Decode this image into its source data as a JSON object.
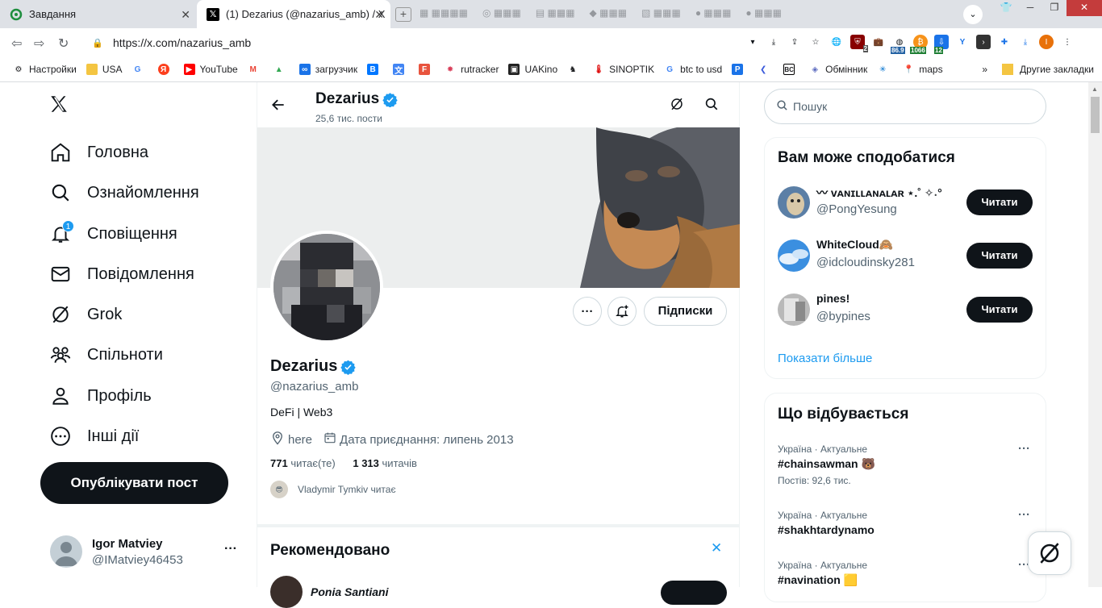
{
  "browser": {
    "tabs": [
      {
        "title": "Завдання",
        "favicon": "green-ring-icon"
      },
      {
        "title": "(1) Dezarius (@nazarius_amb) / X",
        "favicon": "x-logo-icon"
      }
    ],
    "url": "https://x.com/nazarius_amb",
    "bookmarks": [
      {
        "label": "Настройки",
        "icon": "gear-icon"
      },
      {
        "label": "USA",
        "icon": "folder-icon"
      },
      {
        "label": "",
        "icon": "google-icon"
      },
      {
        "label": "",
        "icon": "yandex-icon"
      },
      {
        "label": "YouTube",
        "icon": "youtube-icon"
      },
      {
        "label": "",
        "icon": "gmail-icon"
      },
      {
        "label": "",
        "icon": "drive-icon"
      },
      {
        "label": "загрузчик",
        "icon": "infinity-icon"
      },
      {
        "label": "",
        "icon": "vk-icon"
      },
      {
        "label": "",
        "icon": "translate-icon"
      },
      {
        "label": "",
        "icon": "f-icon"
      },
      {
        "label": "rutracker",
        "icon": "rutracker-icon"
      },
      {
        "label": "UAKino",
        "icon": "uakino-icon"
      },
      {
        "label": "",
        "icon": "chess-icon"
      },
      {
        "label": "SINOPTIK",
        "icon": "thermometer-icon"
      },
      {
        "label": "btc to usd",
        "icon": "google-icon"
      },
      {
        "label": "",
        "icon": "p-icon"
      },
      {
        "label": "",
        "icon": "arrow-icon"
      },
      {
        "label": "",
        "icon": "bc-icon"
      },
      {
        "label": "Обмінник",
        "icon": "exchange-icon"
      },
      {
        "label": "",
        "icon": "walmart-icon"
      },
      {
        "label": "maps",
        "icon": "maps-icon"
      }
    ],
    "bookmarks_more": "»",
    "other_bookmarks": "Другие закладки",
    "extension_badges": [
      "2",
      "86.9",
      "1066",
      "12"
    ],
    "profile_initial": "I"
  },
  "left_nav": {
    "items": [
      {
        "label": "Головна",
        "icon": "home-icon"
      },
      {
        "label": "Ознайомлення",
        "icon": "search-icon"
      },
      {
        "label": "Сповіщення",
        "icon": "bell-icon",
        "badge": "1"
      },
      {
        "label": "Повідомлення",
        "icon": "mail-icon"
      },
      {
        "label": "Grok",
        "icon": "grok-icon"
      },
      {
        "label": "Спільноти",
        "icon": "communities-icon"
      },
      {
        "label": "Профіль",
        "icon": "profile-icon"
      },
      {
        "label": "Інші дії",
        "icon": "more-circle-icon"
      }
    ],
    "post_button": "Опублікувати пост",
    "account": {
      "name": "Igor Matviey",
      "handle": "@IMatviey46453",
      "more": "···"
    }
  },
  "profile": {
    "header_name": "Dezarius",
    "header_posts": "25,6 тис. пости",
    "name": "Dezarius",
    "handle": "@nazarius_amb",
    "bio": "DeFi | Web3",
    "location": "here",
    "joined": "Дата приєднання: липень 2013",
    "following_count": "771",
    "following_label": "читає(те)",
    "followers_count": "1 313",
    "followers_label": "читачів",
    "followed_by": "Vladymir Tymkiv читає",
    "subscribe_button": "Підписки",
    "more_button": "···",
    "recommended_title": "Рекомендовано",
    "recommended_peek_name": "Ponia Santiani",
    "close_icon": "✕"
  },
  "right": {
    "search_placeholder": "Пошук",
    "who_to_follow": {
      "title": "Вам може сподобатися",
      "users": [
        {
          "name": "〰 ᴠᴀɴɪʟʟᴀɴᴀʟᴀʀ ⋆.˚ ✧˖°",
          "handle": "@PongYesung",
          "button": "Читати"
        },
        {
          "name": "WhiteCloud🙈",
          "handle": "@idcloudinsky281",
          "button": "Читати"
        },
        {
          "name": "pines!",
          "handle": "@bypines",
          "button": "Читати"
        }
      ],
      "show_more": "Показати більше"
    },
    "trends": {
      "title": "Що відбувається",
      "items": [
        {
          "meta": "Україна · Актуальне",
          "tag": "#chainsawman 🐻",
          "count": "Постів: 92,6 тис."
        },
        {
          "meta": "Україна · Актуальне",
          "tag": "#shakhtardynamo",
          "count": ""
        },
        {
          "meta": "Україна · Актуальне",
          "tag": "#navination 🟨",
          "count": ""
        }
      ]
    }
  },
  "colors": {
    "accent": "#1d9bf0",
    "text": "#0f1419",
    "muted": "#536471",
    "border": "#eff3f4"
  }
}
